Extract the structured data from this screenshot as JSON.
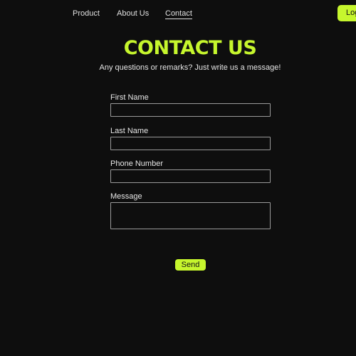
{
  "nav": {
    "items": [
      {
        "label": "Product"
      },
      {
        "label": "About Us"
      },
      {
        "label": "Contact"
      }
    ],
    "login_label": "Login"
  },
  "header": {
    "title": "CONTACT US",
    "subtitle": "Any questions or remarks? Just write us a message!"
  },
  "form": {
    "first_name": {
      "label": "First Name",
      "value": ""
    },
    "last_name": {
      "label": "Last Name",
      "value": ""
    },
    "phone": {
      "label": "Phone Number",
      "value": ""
    },
    "message": {
      "label": "Message",
      "value": ""
    },
    "send_label": "Send"
  },
  "colors": {
    "accent": "#c6f62d",
    "background": "#0e0e0e"
  }
}
